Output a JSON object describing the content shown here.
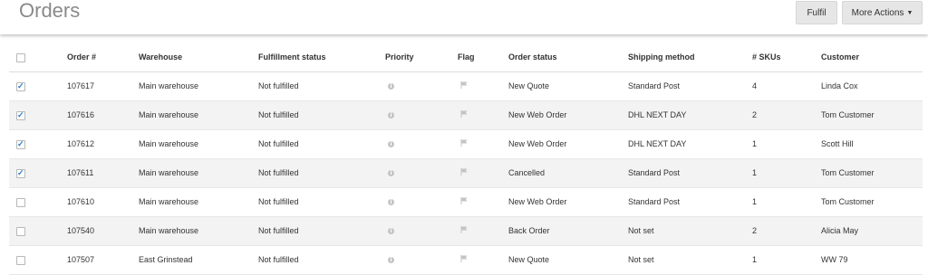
{
  "header": {
    "title": "Orders",
    "fulfil_label": "Fulfil",
    "more_actions_label": "More Actions",
    "more_actions_chevron": "⌄"
  },
  "table": {
    "columns": {
      "order": "Order #",
      "warehouse": "Warehouse",
      "fulfillment": "Fulfillment status",
      "priority": "Priority",
      "flag": "Flag",
      "status": "Order status",
      "shipping": "Shipping method",
      "skus": "# SKUs",
      "customer": "Customer"
    },
    "rows": [
      {
        "checked": true,
        "order": "107617",
        "warehouse": "Main warehouse",
        "fulfillment": "Not fulfilled",
        "status": "New Quote",
        "shipping": "Standard Post",
        "skus": "4",
        "customer": "Linda Cox"
      },
      {
        "checked": true,
        "order": "107616",
        "warehouse": "Main warehouse",
        "fulfillment": "Not fulfilled",
        "status": "New Web Order",
        "shipping": "DHL NEXT DAY",
        "skus": "2",
        "customer": "Tom Customer"
      },
      {
        "checked": true,
        "order": "107612",
        "warehouse": "Main warehouse",
        "fulfillment": "Not fulfilled",
        "status": "New Web Order",
        "shipping": "DHL NEXT DAY",
        "skus": "1",
        "customer": "Scott Hill"
      },
      {
        "checked": true,
        "order": "107611",
        "warehouse": "Main warehouse",
        "fulfillment": "Not fulfilled",
        "status": "Cancelled",
        "shipping": "Standard Post",
        "skus": "1",
        "customer": "Tom Customer"
      },
      {
        "checked": false,
        "order": "107610",
        "warehouse": "Main warehouse",
        "fulfillment": "Not fulfilled",
        "status": "New Web Order",
        "shipping": "Standard Post",
        "skus": "1",
        "customer": "Tom Customer"
      },
      {
        "checked": false,
        "order": "107540",
        "warehouse": "Main warehouse",
        "fulfillment": "Not fulfilled",
        "status": "Back Order",
        "shipping": "Not set",
        "skus": "2",
        "customer": "Alicia May"
      },
      {
        "checked": false,
        "order": "107507",
        "warehouse": "East Grinstead",
        "fulfillment": "Not fulfilled",
        "status": "New Quote",
        "shipping": "Not set",
        "skus": "1",
        "customer": "WW 79"
      }
    ]
  },
  "icons": {
    "priority": "info-icon",
    "flag": "flag-icon",
    "checkbox_tick": "✓"
  },
  "colors": {
    "accent_check": "#2a7ad1",
    "button_bg": "#e6e6e6",
    "row_shade": "#f3f3f3"
  }
}
